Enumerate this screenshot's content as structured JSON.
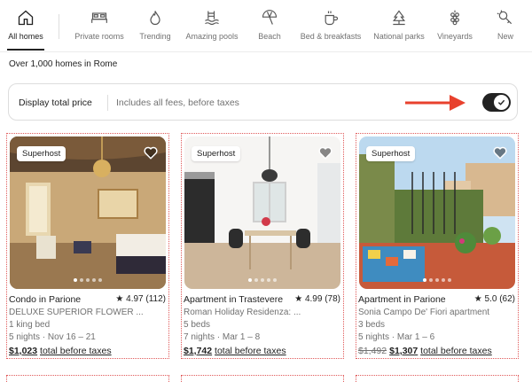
{
  "categories": [
    {
      "label": "All homes",
      "icon": "home-icon",
      "active": true
    },
    {
      "label": "Private rooms",
      "icon": "bed-icon"
    },
    {
      "label": "Trending",
      "icon": "flame-icon"
    },
    {
      "label": "Amazing pools",
      "icon": "pool-icon"
    },
    {
      "label": "Beach",
      "icon": "umbrella-icon"
    },
    {
      "label": "Bed & breakfasts",
      "icon": "coffee-icon"
    },
    {
      "label": "National parks",
      "icon": "tree-icon"
    },
    {
      "label": "Vineyards",
      "icon": "grapes-icon"
    },
    {
      "label": "New",
      "icon": "sparkle-key-icon"
    }
  ],
  "results_count": "Over 1,000 homes in Rome",
  "price_toggle": {
    "title": "Display total price",
    "subtitle": "Includes all fees, before taxes",
    "on": true
  },
  "listings": [
    {
      "badge": "Superhost",
      "title": "Condo in Parione",
      "rating": "4.97 (112)",
      "line1": "DELUXE SUPERIOR FLOWER ...",
      "line2": "1 king bed",
      "line3": "5 nights · Nov 16 – 21",
      "price": "$1,023",
      "price_suffix": "total before taxes"
    },
    {
      "badge": "Superhost",
      "title": "Apartment in Trastevere",
      "rating": "4.99 (78)",
      "line1": "Roman Holiday Residenza: ...",
      "line2": "5 beds",
      "line3": "7 nights · Mar 1 – 8",
      "price": "$1,742",
      "price_suffix": "total before taxes"
    },
    {
      "badge": "Superhost",
      "title": "Apartment in Parione",
      "rating": "5.0 (62)",
      "line1": "Sonia Campo De' Fiori apartment",
      "line2": "3 beds",
      "line3": "5 nights · Mar 1 – 6",
      "old_price": "$1,492",
      "price": "$1,307",
      "price_suffix": "total before taxes"
    }
  ],
  "colors": {
    "arrow": "#e8412d",
    "text": "#222222",
    "muted": "#717171",
    "card_outline": "#e05a5a"
  }
}
